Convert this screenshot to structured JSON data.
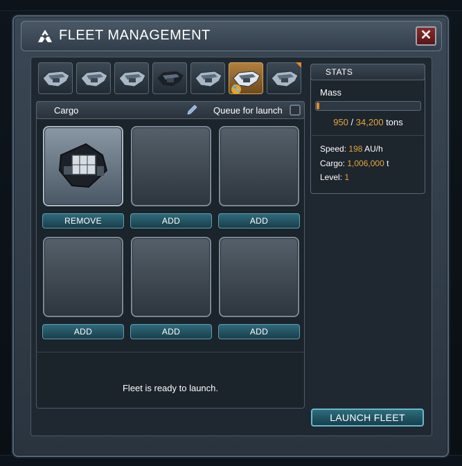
{
  "window": {
    "title": "FLEET MANAGEMENT",
    "close_label": "✕"
  },
  "ships": [
    {
      "icon": "frigate-icon",
      "active": false
    },
    {
      "icon": "frigate-icon",
      "active": false
    },
    {
      "icon": "frigate-icon",
      "active": false
    },
    {
      "icon": "destroyer-icon",
      "active": false
    },
    {
      "icon": "freighter-icon",
      "active": false
    },
    {
      "icon": "cruiser-icon",
      "active": true
    },
    {
      "icon": "freighter-icon",
      "active": false
    }
  ],
  "cargo": {
    "title": "Cargo",
    "queue_label": "Queue for launch",
    "slots": [
      {
        "filled": true,
        "button": "REMOVE"
      },
      {
        "filled": false,
        "button": "ADD"
      },
      {
        "filled": false,
        "button": "ADD"
      },
      {
        "filled": false,
        "button": "ADD"
      },
      {
        "filled": false,
        "button": "ADD"
      },
      {
        "filled": false,
        "button": "ADD"
      }
    ],
    "status": "Fleet is ready to launch."
  },
  "stats": {
    "title": "STATS",
    "mass_label": "Mass",
    "mass_current": "950",
    "mass_separator": "/",
    "mass_max": "34,200",
    "mass_unit": "tons",
    "mass_fraction": 0.028,
    "speed_label": "Speed:",
    "speed_value": "198",
    "speed_unit": "AU/h",
    "cargo_label": "Cargo:",
    "cargo_value": "1,006,000",
    "cargo_unit": "t",
    "level_label": "Level:",
    "level_value": "1"
  },
  "launch_button": "LAUNCH FLEET",
  "colors": {
    "accent": "#e8a53a",
    "button": "#2f6a7a",
    "panel": "#1f2830"
  }
}
